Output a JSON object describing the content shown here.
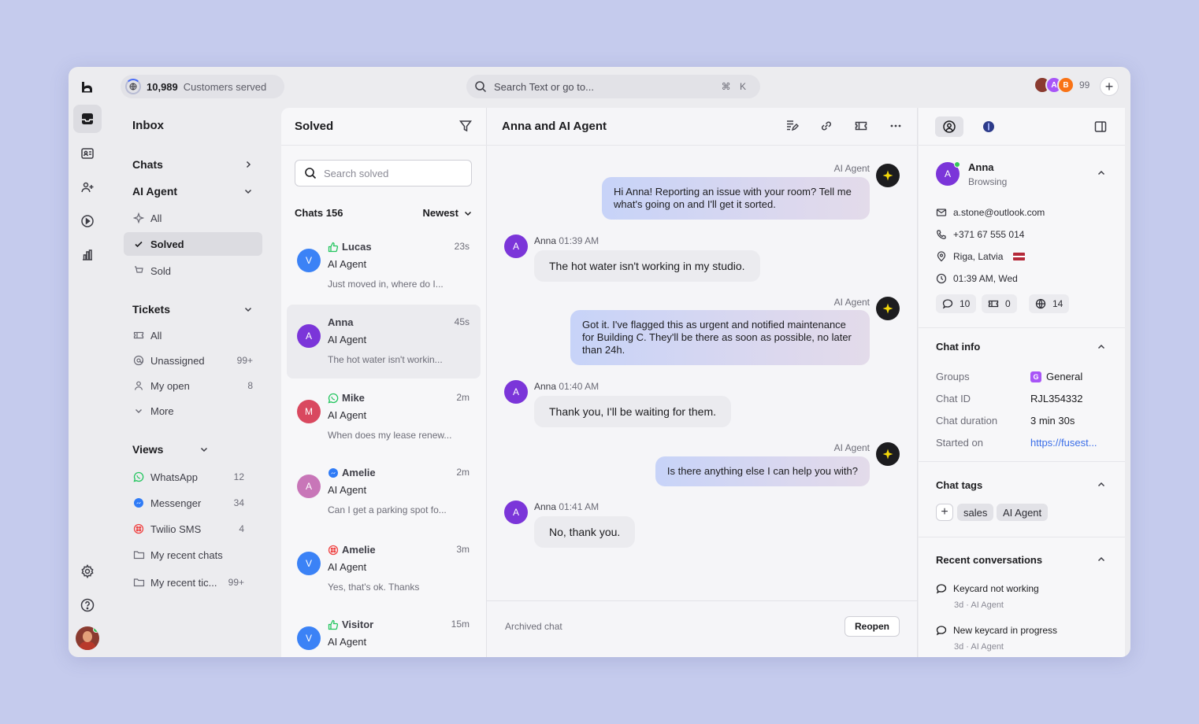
{
  "topbar": {
    "customers_count": "10,989",
    "customers_label": "Customers served",
    "search_placeholder": "Search Text or go to...",
    "search_shortcut": "⌘ K",
    "avatar_count": "99"
  },
  "nav": {
    "title": "Inbox",
    "chats": "Chats",
    "ai_agent": "AI Agent",
    "ai_items": [
      {
        "label": "All",
        "icon": "sparkle-icon"
      },
      {
        "label": "Solved",
        "icon": "check-icon"
      },
      {
        "label": "Sold",
        "icon": "cart-icon"
      }
    ],
    "tickets": "Tickets",
    "ticket_items": [
      {
        "label": "All",
        "count": ""
      },
      {
        "label": "Unassigned",
        "count": "99+"
      },
      {
        "label": "My open",
        "count": "8"
      },
      {
        "label": "More",
        "count": ""
      }
    ],
    "views": "Views",
    "view_items": [
      {
        "label": "WhatsApp",
        "count": "12"
      },
      {
        "label": "Messenger",
        "count": "34"
      },
      {
        "label": "Twilio SMS",
        "count": "4"
      },
      {
        "label": "My recent chats",
        "count": ""
      },
      {
        "label": "My recent tic...",
        "count": "99+"
      }
    ]
  },
  "list": {
    "title": "Solved",
    "search_placeholder": "Search solved",
    "chats_count": "Chats 156",
    "sort": "Newest",
    "items": [
      {
        "initial": "V",
        "name": "Lucas",
        "time": "23s",
        "agent": "AI Agent",
        "snippet": "Just moved in, where do I...",
        "color": "#3b82f6",
        "channel": "thumbs-up-icon"
      },
      {
        "initial": "A",
        "name": "Anna",
        "time": "45s",
        "agent": "AI Agent",
        "snippet": "The hot water isn't workin...",
        "color": "#7b35d9",
        "channel": ""
      },
      {
        "initial": "M",
        "name": "Mike",
        "time": "2m",
        "agent": "AI Agent",
        "snippet": "When does my lease renew...",
        "color": "#d9485f",
        "channel": "whatsapp-icon"
      },
      {
        "initial": "A",
        "name": "Amelie",
        "time": "2m",
        "agent": "AI Agent",
        "snippet": "Can I get a parking spot fo...",
        "color": "#c876b8",
        "channel": "messenger-icon"
      },
      {
        "initial": "V",
        "name": "Amelie",
        "time": "3m",
        "agent": "AI Agent",
        "snippet": "Yes, that's ok. Thanks",
        "color": "#3b82f6",
        "channel": "twilio-icon"
      },
      {
        "initial": "V",
        "name": "Visitor",
        "time": "15m",
        "agent": "AI Agent",
        "snippet": "",
        "color": "#3b82f6",
        "channel": "thumbs-up-icon"
      }
    ]
  },
  "chat": {
    "title": "Anna and AI Agent",
    "ai_label": "AI Agent",
    "messages": [
      {
        "from": "ai",
        "text": "Hi Anna! Reporting an issue with your room? Tell me what's going on and I'll get it sorted."
      },
      {
        "from": "customer",
        "name": "Anna",
        "time": "01:39 AM",
        "text": "The hot water isn't working in my studio."
      },
      {
        "from": "ai",
        "text": "Got it. I've flagged this as urgent and notified maintenance for Building C. They'll be there as soon as possible, no later than 24h."
      },
      {
        "from": "customer",
        "name": "Anna",
        "time": "01:40 AM",
        "text": "Thank you, I'll be waiting for them."
      },
      {
        "from": "ai",
        "text": "Is there anything else I can help you with?"
      },
      {
        "from": "customer",
        "name": "Anna",
        "time": "01:41 AM",
        "text": "No, thank you."
      }
    ],
    "customer_initial": "A",
    "footer_status": "Archived chat",
    "reopen_label": "Reopen"
  },
  "info": {
    "customer": {
      "initial": "A",
      "name": "Anna",
      "status": "Browsing"
    },
    "contact": {
      "email": "a.stone@outlook.com",
      "phone": "+371 67 555 014",
      "location": "Riga, Latvia",
      "local_time": "01:39 AM, Wed"
    },
    "stats": {
      "chats": "10",
      "tickets": "0",
      "visits": "14"
    },
    "chat_info_title": "Chat info",
    "chat_info": {
      "groups_k": "Groups",
      "groups_v": "General",
      "groups_badge": "G",
      "id_k": "Chat ID",
      "id_v": "RJL354332",
      "duration_k": "Chat duration",
      "duration_v": "3 min 30s",
      "started_k": "Started on",
      "started_v": "https://fusest..."
    },
    "tags_title": "Chat tags",
    "tags": [
      "sales",
      "AI Agent"
    ],
    "recent_title": "Recent conversations",
    "recent": [
      {
        "title": "Keycard not working",
        "meta": "3d · AI Agent"
      },
      {
        "title": "New keycard in progress",
        "meta": "3d · AI Agent"
      }
    ]
  }
}
